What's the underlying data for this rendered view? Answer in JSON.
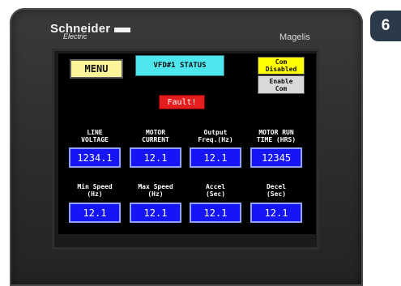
{
  "device": {
    "brand": "Schneider",
    "brand_sub": "Electric",
    "model": "Magelis"
  },
  "badge": "6",
  "hmi": {
    "menu_button": "MENU",
    "title": "VFD#1 STATUS",
    "com_disabled": [
      "Com",
      "Disabled"
    ],
    "enable_com": [
      "Enable",
      "Com"
    ],
    "fault": "Fault!",
    "row1": [
      {
        "label": [
          "LINE",
          "VOLTAGE"
        ],
        "value": "1234.1"
      },
      {
        "label": [
          "MOTOR",
          "CURRENT"
        ],
        "value": "12.1"
      },
      {
        "label": [
          "Output",
          "Freq.(Hz)"
        ],
        "value": "12.1"
      },
      {
        "label": [
          "MOTOR RUN",
          "TIME (HRS)"
        ],
        "value": "12345"
      }
    ],
    "row2": [
      {
        "label": [
          "Min Speed",
          "(Hz)"
        ],
        "value": "12.1"
      },
      {
        "label": [
          "Max Speed",
          "(Hz)"
        ],
        "value": "12.1"
      },
      {
        "label": [
          "Accel",
          "(Sec)"
        ],
        "value": "12.1"
      },
      {
        "label": [
          "Decel",
          "(Sec)"
        ],
        "value": "12.1"
      }
    ]
  },
  "colors": {
    "menu_bg": "#fbf49a",
    "title_bg": "#4fe7ee",
    "com_disabled_bg": "#ffff00",
    "enable_com_bg": "#d9d9d9",
    "fault_bg": "#e41e1e",
    "value_bg": "#1515f5",
    "screen_bg": "#000000"
  }
}
